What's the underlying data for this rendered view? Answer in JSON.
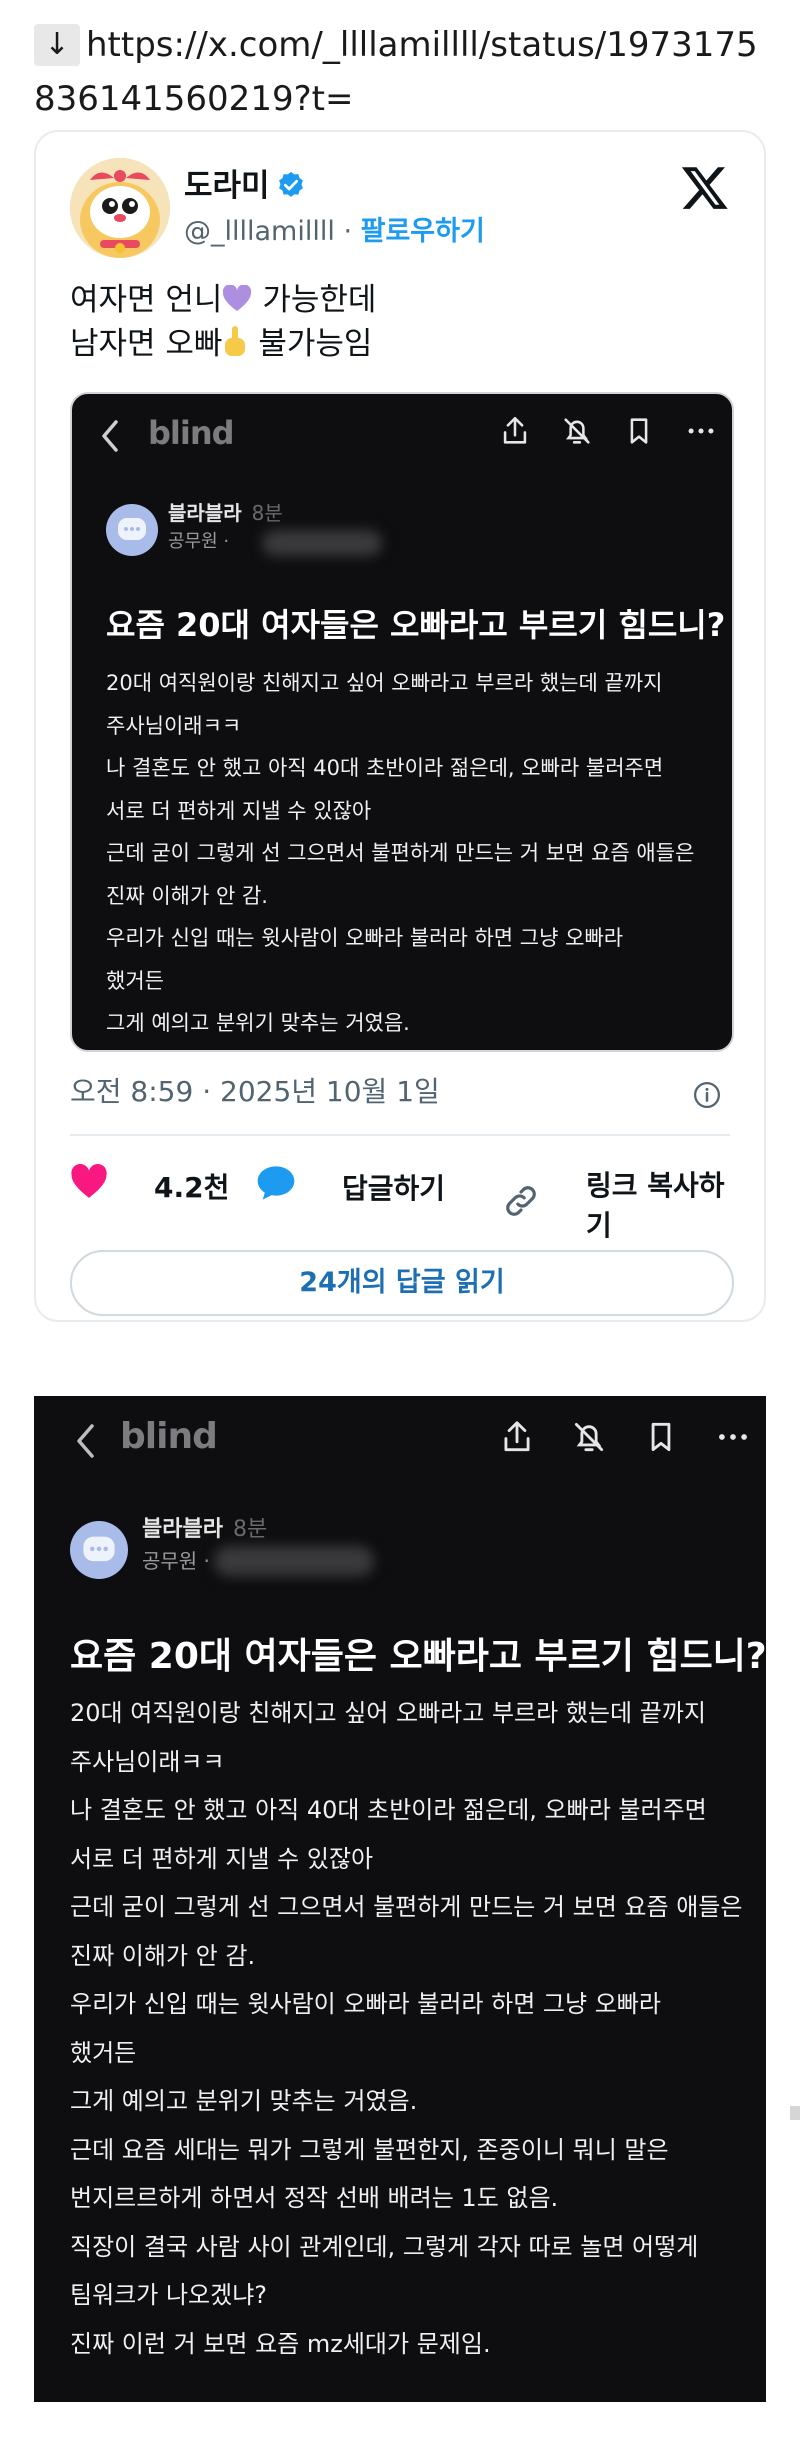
{
  "url_line": {
    "arrow": "↓",
    "text": "https://x.com/_llllamillll/status/1973175836141560219?t="
  },
  "tweet": {
    "author_name": "도라미",
    "handle": "@_llllamillll",
    "separator": " · ",
    "follow_label": "팔로우하기",
    "text_line1_a": "여자면 언니",
    "text_line1_b": " 가능한데",
    "text_line2_a": "남자면 오빠",
    "text_line2_b": " 불가능임",
    "timestamp": "오전 8:59 · 2025년 10월 1일",
    "likes": "4.2천",
    "reply_label": "답글하기",
    "copy_link_label": "링크 복사하기",
    "read_replies_label": "24개의 답글 읽기",
    "colors": {
      "like": "#f91880",
      "link": "#1d9bf0",
      "verified": "#1d9bf0"
    }
  },
  "blind_embed": {
    "logo": "blind",
    "author": "블라블라",
    "time": "8분",
    "role": "공무원 ·",
    "title": "요즘 20대 여자들은 오빠라고 부르기 힘드니?",
    "lines": [
      "20대 여직원이랑 친해지고 싶어 오빠라고 부르라 했는데 끝까지",
      "주사님이래ㅋㅋ",
      "나 결혼도 안 했고 아직 40대 초반이라 젊은데, 오빠라 불러주면",
      "서로 더 편하게 지낼 수 있잖아",
      "근데 굳이 그렇게 선 그으면서 불편하게 만드는 거 보면 요즘 애들은",
      "진짜 이해가 안 감.",
      "우리가 신입 때는 윗사람이 오빠라 불러라 하면 그냥 오빠라",
      "했거든",
      "그게 예의고 분위기 맞추는 거였음."
    ]
  },
  "blind_full": {
    "logo": "blind",
    "author": "블라블라",
    "time": "8분",
    "role": "공무원 ·",
    "title": "요즘 20대 여자들은 오빠라고 부르기 힘드니?",
    "lines": [
      "20대 여직원이랑 친해지고 싶어 오빠라고 부르라 했는데 끝까지",
      "주사님이래ㅋㅋ",
      "나 결혼도 안 했고 아직 40대 초반이라 젊은데, 오빠라 불러주면",
      "서로 더 편하게 지낼 수 있잖아",
      "근데 굳이 그렇게 선 그으면서 불편하게 만드는 거 보면 요즘 애들은",
      "진짜 이해가 안 감.",
      "우리가 신입 때는 윗사람이 오빠라 불러라 하면 그냥 오빠라",
      "했거든",
      "그게 예의고 분위기 맞추는 거였음.",
      "근데 요즘 세대는 뭐가 그렇게 불편한지, 존중이니 뭐니 말은",
      "번지르르하게 하면서 정작 선배 배려는 1도 없음.",
      "직장이 결국 사람 사이 관계인데, 그렇게 각자 따로 놀면 어떻게",
      "팀워크가 나오겠냐?",
      " 진짜  이런 거 보면 요즘 mz세대가 문제임."
    ]
  },
  "icons": {
    "download": "arrow-down-icon",
    "verified": "verified-badge-icon",
    "brand": "x-logo-icon",
    "share": "share-icon",
    "mute": "bell-off-icon",
    "bookmark": "bookmark-icon",
    "more": "more-icon",
    "like": "heart-icon",
    "reply": "speech-bubble-icon",
    "link": "link-icon",
    "info": "info-icon"
  }
}
